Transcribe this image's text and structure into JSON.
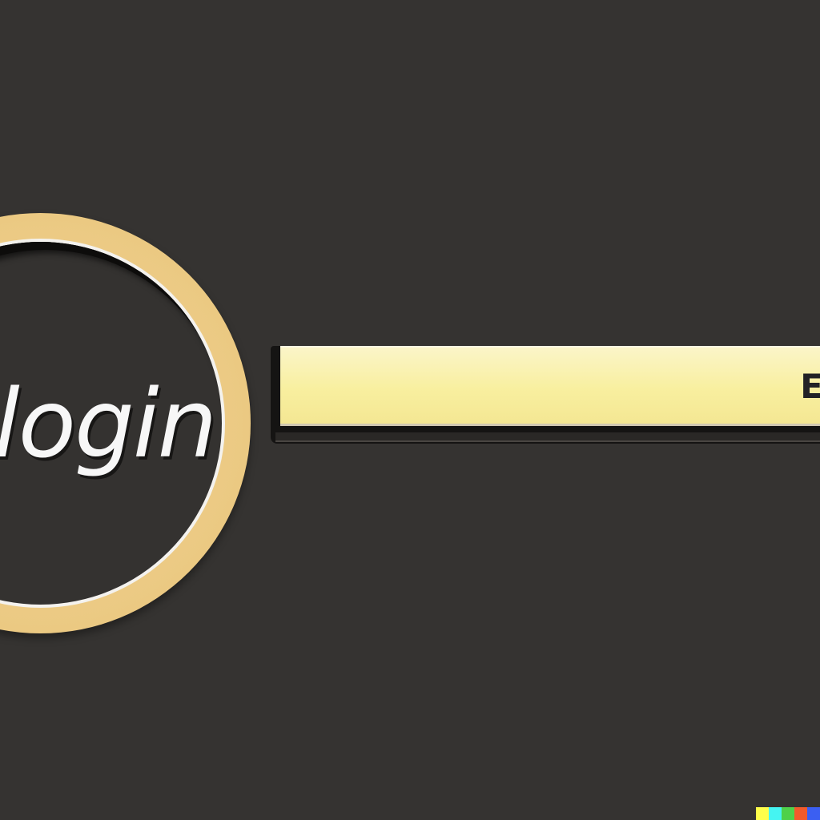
{
  "login": {
    "label": "login"
  },
  "search": {
    "value": "E"
  },
  "colors": {
    "background": "#353331",
    "ring_gold": "#ebc982",
    "field_yellow": "#f8ef9f",
    "label_white": "#f7f7f7"
  },
  "watermark": {
    "stripe_colors": [
      "#fefe4a",
      "#45f4f2",
      "#4ed14a",
      "#f25a2b",
      "#3b5ff2"
    ]
  }
}
